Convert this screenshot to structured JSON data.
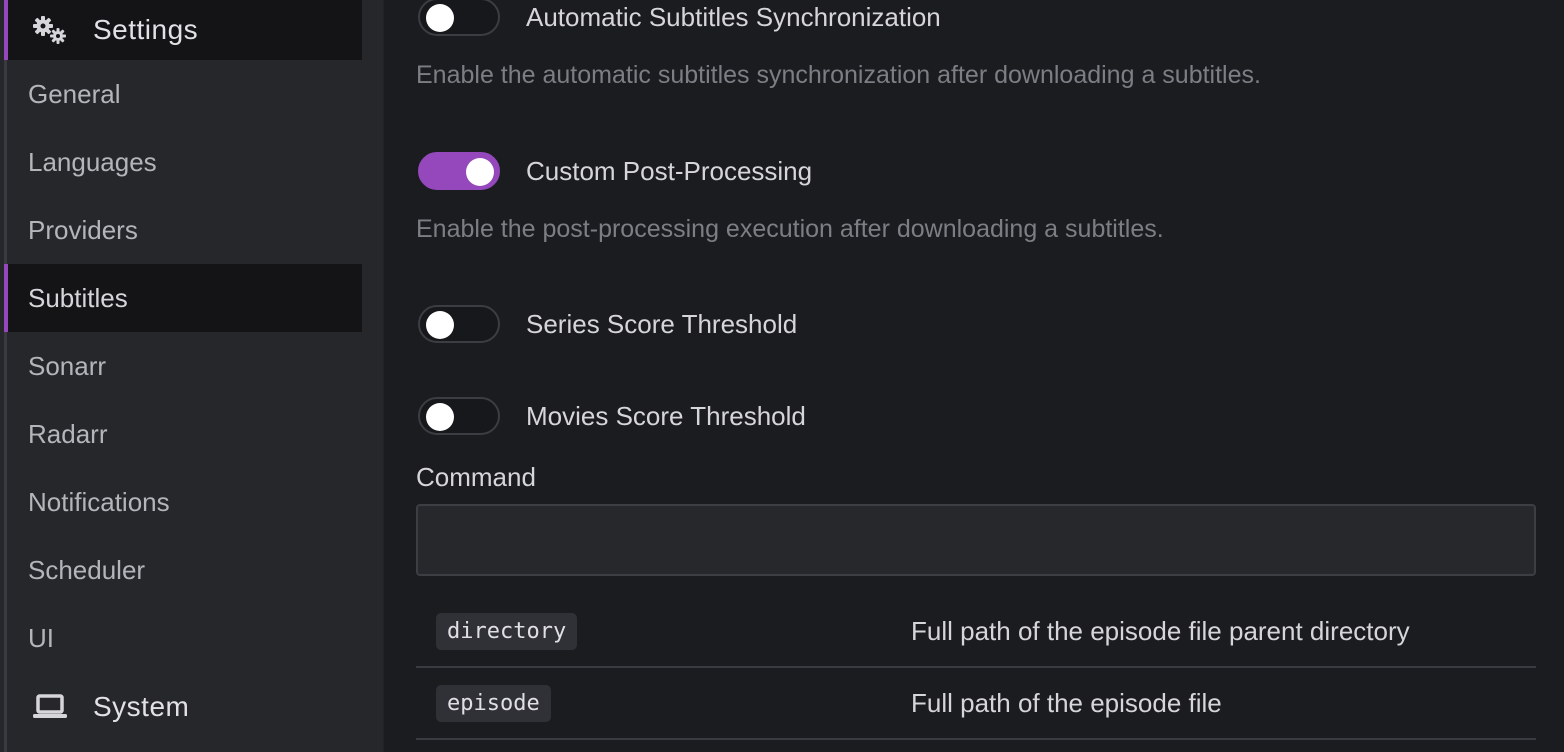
{
  "sidebar": {
    "settings_label": "Settings",
    "settings_icon": "gears-icon",
    "items": [
      {
        "label": "General",
        "active": false
      },
      {
        "label": "Languages",
        "active": false
      },
      {
        "label": "Providers",
        "active": false
      },
      {
        "label": "Subtitles",
        "active": true
      },
      {
        "label": "Sonarr",
        "active": false
      },
      {
        "label": "Radarr",
        "active": false
      },
      {
        "label": "Notifications",
        "active": false
      },
      {
        "label": "Scheduler",
        "active": false
      },
      {
        "label": "UI",
        "active": false
      }
    ],
    "system_label": "System",
    "system_icon": "laptop-icon"
  },
  "main": {
    "auto_sync": {
      "label": "Automatic Subtitles Synchronization",
      "enabled": false,
      "description": "Enable the automatic subtitles synchronization after downloading a subtitles."
    },
    "post_processing": {
      "label": "Custom Post-Processing",
      "enabled": true,
      "description": "Enable the post-processing execution after downloading a subtitles."
    },
    "series_threshold": {
      "label": "Series Score Threshold",
      "enabled": false
    },
    "movies_threshold": {
      "label": "Movies Score Threshold",
      "enabled": false
    },
    "command": {
      "label": "Command",
      "value": "",
      "placeholder": ""
    },
    "variables": [
      {
        "name": "directory",
        "description": "Full path of the episode file parent directory"
      },
      {
        "name": "episode",
        "description": "Full path of the episode file"
      }
    ]
  },
  "colors": {
    "accent": "#9448bc",
    "background": "#1b1c20",
    "sidebar": "#26272b"
  }
}
